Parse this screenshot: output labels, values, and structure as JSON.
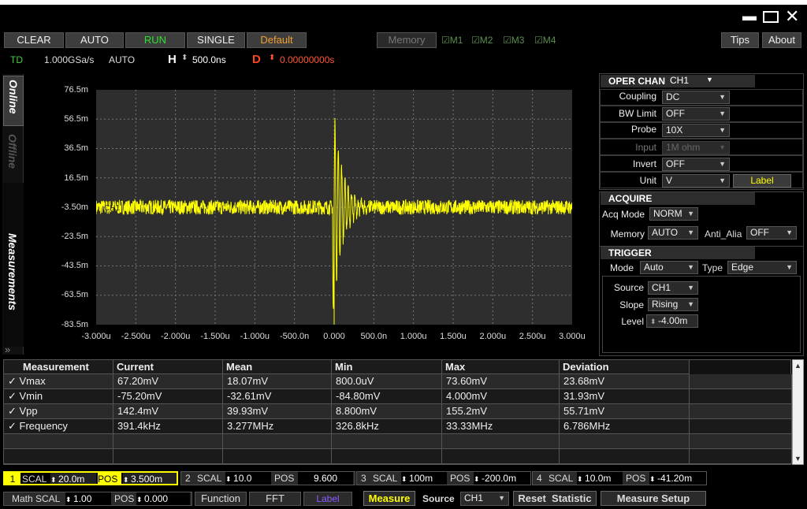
{
  "toolbar": {
    "clear": "CLEAR",
    "auto": "AUTO",
    "run": "RUN",
    "single": "SINGLE",
    "default": "Default",
    "memory": "Memory",
    "m1": "M1",
    "m2": "M2",
    "m3": "M3",
    "m4": "M4",
    "tips": "Tips",
    "about": "About"
  },
  "status": {
    "td": "TD",
    "sample_rate": "1.000GSa/s",
    "mode": "AUTO",
    "h_label": "H",
    "h_value": "500.0ns",
    "d_label": "D",
    "d_value": "0.00000000s"
  },
  "side_tabs": {
    "online": "Online",
    "offline": "Offline",
    "measurements": "Measurements"
  },
  "chart_data": {
    "type": "line",
    "y_ticks": [
      "76.5m",
      "56.5m",
      "36.5m",
      "16.5m",
      "-3.50m",
      "-23.5m",
      "-43.5m",
      "-63.5m",
      "-83.5m"
    ],
    "x_ticks": [
      "-3.000u",
      "-2.500u",
      "-2.000u",
      "-1.500u",
      "-1.000u",
      "-500.0n",
      "0.000",
      "500.0n",
      "1.000u",
      "1.500u",
      "2.000u",
      "2.500u",
      "3.000u"
    ],
    "ylim": [
      -83.5,
      76.5
    ],
    "xlim": [
      -3.0,
      3.0
    ],
    "channel_marker": "CH1",
    "trace_color": "#ffff00",
    "grid": true
  },
  "channel_panel": {
    "oper_chan_label": "OPER CHAN",
    "oper_chan_value": "CH1",
    "coupling_label": "Coupling",
    "coupling": "DC",
    "bw_label": "BW Limit",
    "bw": "OFF",
    "probe_label": "Probe",
    "probe": "10X",
    "input_label": "Input",
    "input": "1M ohm",
    "invert_label": "Invert",
    "invert": "OFF",
    "unit_label": "Unit",
    "unit": "V",
    "label_btn": "Label"
  },
  "acquire": {
    "title": "ACQUIRE",
    "acq_mode_label": "Acq Mode",
    "acq_mode": "NORM",
    "memory_label": "Memory",
    "memory": "AUTO",
    "anti_alia_label": "Anti_Alia",
    "anti_alia": "OFF"
  },
  "trigger": {
    "title": "TRIGGER",
    "mode_label": "Mode",
    "mode": "Auto",
    "type_label": "Type",
    "type": "Edge",
    "source_label": "Source",
    "source": "CH1",
    "slope_label": "Slope",
    "slope": "Rising",
    "level_label": "Level",
    "level": "-4.00m"
  },
  "measure_table": {
    "headers": [
      "Measurement",
      "Current",
      "Mean",
      "Min",
      "Max",
      "Deviation"
    ],
    "rows": [
      [
        "Vmax",
        "67.20mV",
        "18.07mV",
        "800.0uV",
        "73.60mV",
        "23.68mV"
      ],
      [
        "Vmin",
        "-75.20mV",
        "-32.61mV",
        "-84.80mV",
        "4.000mV",
        "31.93mV"
      ],
      [
        "Vpp",
        "142.4mV",
        "39.93mV",
        "8.800mV",
        "155.2mV",
        "55.71mV"
      ],
      [
        "Frequency",
        "391.4kHz",
        "3.277MHz",
        "326.8kHz",
        "33.33MHz",
        "6.786MHz"
      ]
    ]
  },
  "bottom": {
    "scal": "SCAL",
    "pos": "POS",
    "ch1": {
      "n": "1",
      "scal": "20.0m",
      "pos": "3.500m"
    },
    "ch2": {
      "n": "2",
      "scal": "10.0",
      "pos": "9.600"
    },
    "ch3": {
      "n": "3",
      "scal": "100m",
      "pos": "-200.0m"
    },
    "ch4": {
      "n": "4",
      "scal": "10.0m",
      "pos": "-41.20m"
    },
    "math_scal_label": "Math SCAL",
    "math_scal": "1.00",
    "math_pos_label": "POS",
    "math_pos": "0.000",
    "function": "Function",
    "fft": "FFT",
    "label": "Label",
    "measure": "Measure",
    "source_label": "Source",
    "source": "CH1",
    "reset_statistic": "Reset  Statistic",
    "measure_setup": "Measure Setup"
  }
}
